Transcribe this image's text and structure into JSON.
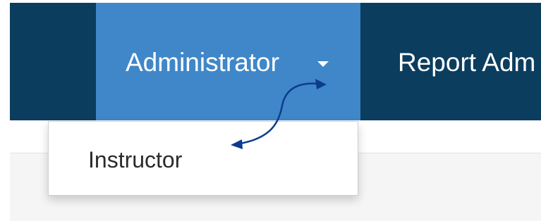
{
  "navbar": {
    "items": [
      {
        "label": "Administrator",
        "icon": "caret-down-icon",
        "active": true
      },
      {
        "label": "Report Adm"
      }
    ]
  },
  "dropdown": {
    "items": [
      {
        "label": "Instructor"
      }
    ]
  },
  "colors": {
    "navbar_bg": "#0b3d5e",
    "active_item_bg": "#3f87c8",
    "nav_text": "#ffffff",
    "annotation_arrow": "#0d3c8c",
    "dropdown_text": "#2b2b2b"
  }
}
